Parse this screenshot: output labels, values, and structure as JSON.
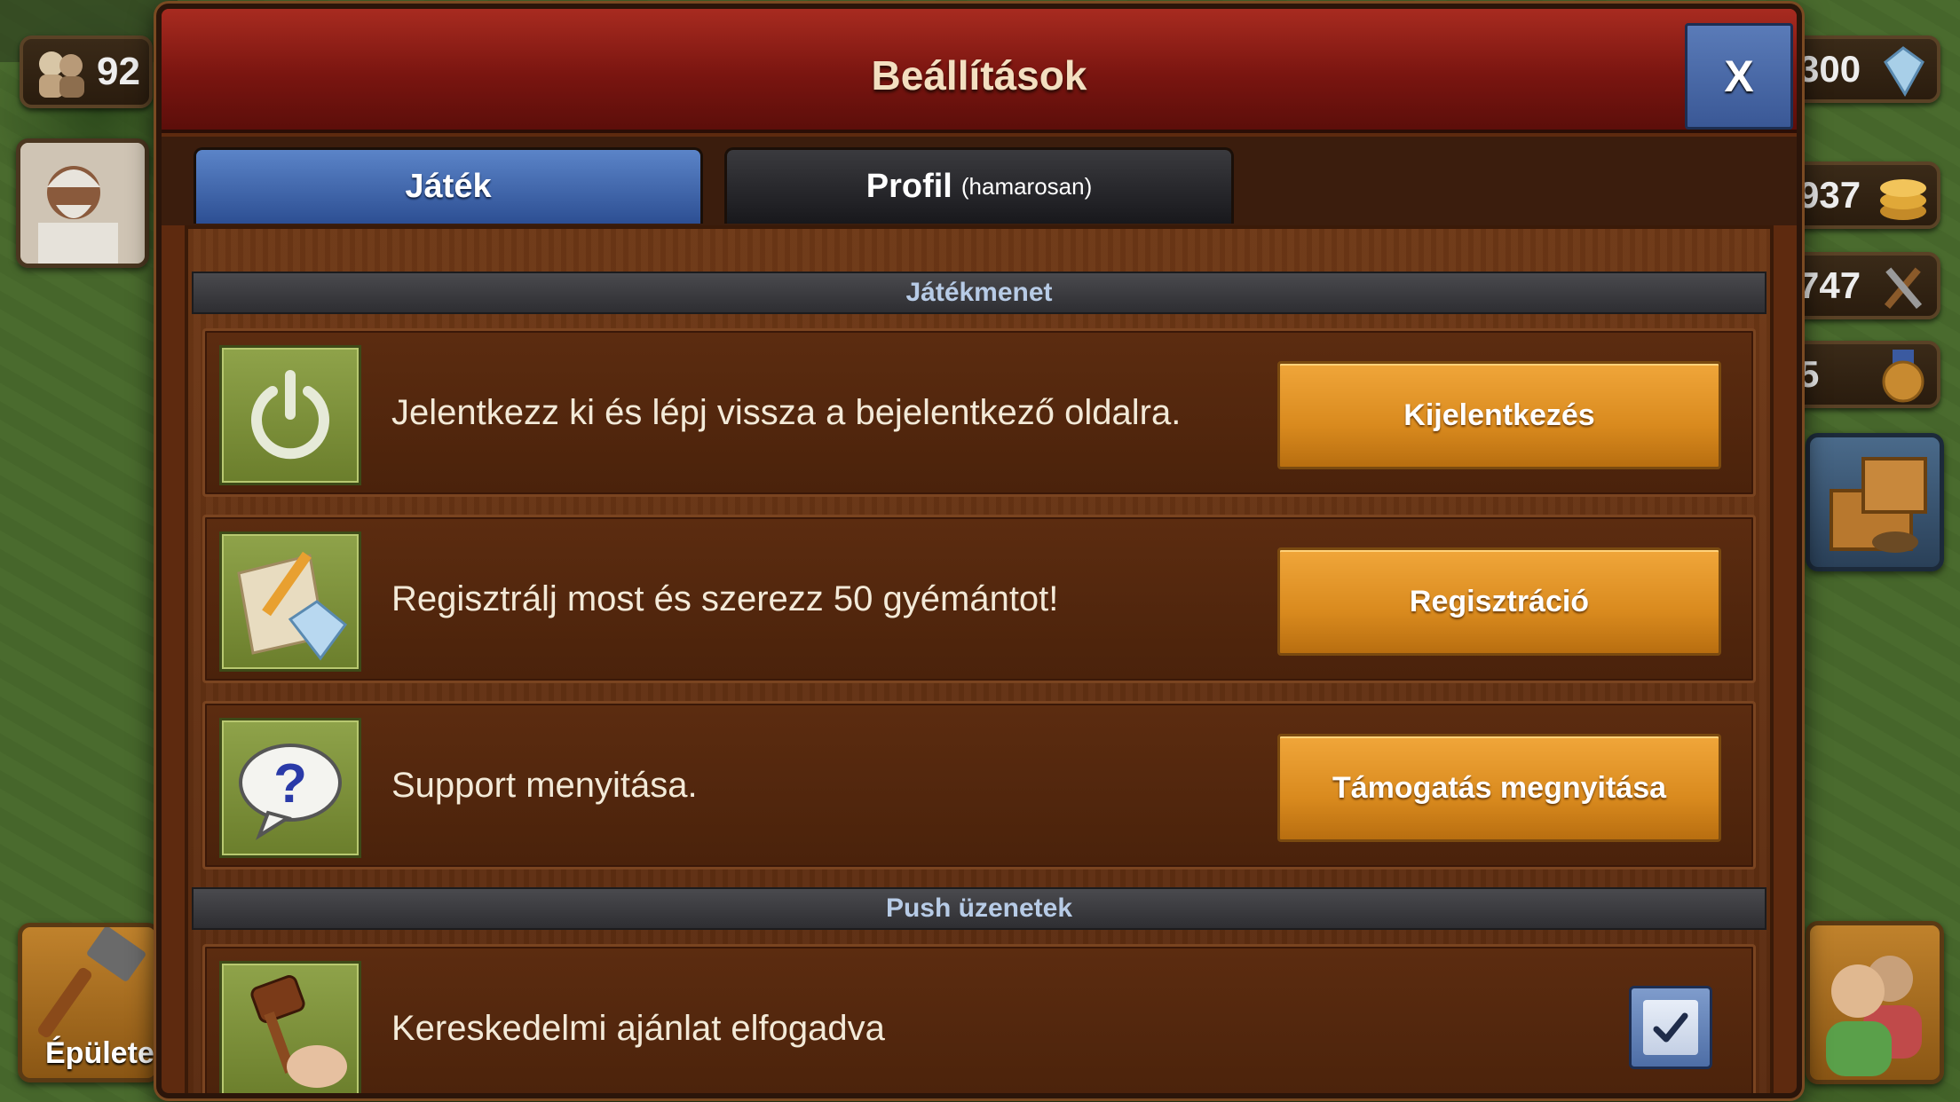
{
  "hud": {
    "population": "92",
    "diamonds": "300",
    "coins": "937",
    "supplies": "747",
    "medals": "5",
    "buildings_label": "Épületek"
  },
  "dialog": {
    "title": "Beállítások",
    "close_label": "X",
    "tabs": [
      {
        "label": "Játék",
        "active": true
      },
      {
        "label": "Profil",
        "sublabel": "(hamarosan)",
        "active": false
      }
    ]
  },
  "sections": {
    "gameplay": "Játékmenet",
    "push": "Push üzenetek"
  },
  "rows": [
    {
      "icon": "power-icon",
      "text": "Jelentkezz ki és lépj vissza a bejelentkező oldalra.",
      "button": "Kijelentkezés"
    },
    {
      "icon": "register-icon",
      "text": "Regisztrálj most és szerezz 50 gyémántot!",
      "button": "Regisztráció"
    },
    {
      "icon": "help-icon",
      "text": "Support menyitása.",
      "button": "Támogatás megnyitása"
    }
  ],
  "push_rows": [
    {
      "icon": "gavel-icon",
      "text": "Kereskedelmi ajánlat elfogadva",
      "checked": true
    }
  ],
  "colors": {
    "title_bar": "#7a1510",
    "active_tab": "#3d63a8",
    "button": "#d98a1e",
    "icon_bg": "#7e913c"
  }
}
